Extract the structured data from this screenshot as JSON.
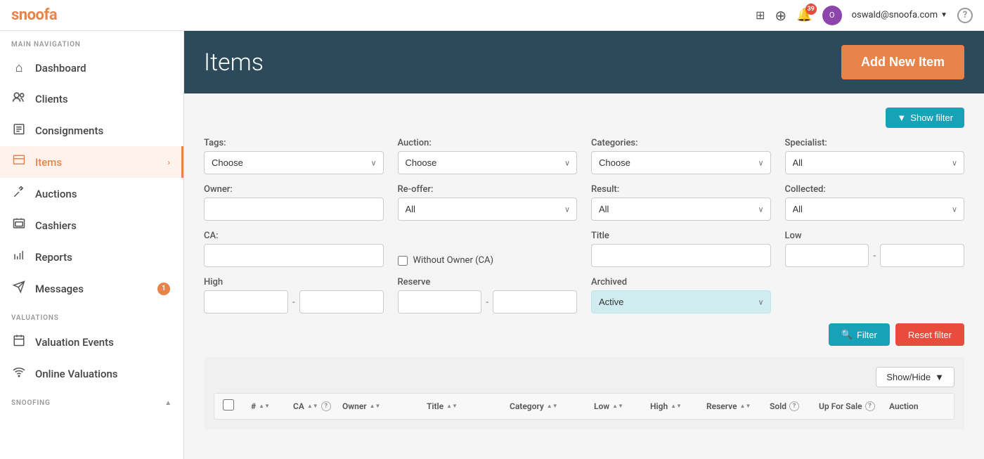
{
  "topbar": {
    "logo_part1": "snoo",
    "logo_part2": "fa",
    "notification_count": "39",
    "user_email": "oswald@snoofa.com"
  },
  "sidebar": {
    "main_nav_label": "MAIN NAVIGATION",
    "items": [
      {
        "id": "dashboard",
        "label": "Dashboard",
        "icon": "⌂",
        "active": false
      },
      {
        "id": "clients",
        "label": "Clients",
        "icon": "👥",
        "active": false
      },
      {
        "id": "consignments",
        "label": "Consignments",
        "icon": "📋",
        "active": false
      },
      {
        "id": "items",
        "label": "Items",
        "icon": "🏷",
        "active": true,
        "chevron": true
      },
      {
        "id": "auctions",
        "label": "Auctions",
        "icon": "✏",
        "active": false
      },
      {
        "id": "cashiers",
        "label": "Cashiers",
        "icon": "🖥",
        "active": false
      },
      {
        "id": "reports",
        "label": "Reports",
        "icon": "📊",
        "active": false
      },
      {
        "id": "messages",
        "label": "Messages",
        "icon": "✉",
        "active": false,
        "badge": "1"
      }
    ],
    "valuations_label": "VALUATIONS",
    "valuations_items": [
      {
        "id": "valuation-events",
        "label": "Valuation Events",
        "icon": "📅"
      },
      {
        "id": "online-valuations",
        "label": "Online Valuations",
        "icon": "📡"
      }
    ],
    "snoofing_label": "SNOOFING"
  },
  "page_header": {
    "title": "Items",
    "add_button_label": "Add New Item"
  },
  "filters": {
    "show_filter_label": "Show filter",
    "tags_label": "Tags:",
    "tags_placeholder": "Choose",
    "auction_label": "Auction:",
    "auction_placeholder": "Choose",
    "categories_label": "Categories:",
    "categories_placeholder": "Choose",
    "specialist_label": "Specialist:",
    "specialist_placeholder": "All",
    "owner_label": "Owner:",
    "reoffer_label": "Re-offer:",
    "reoffer_value": "All",
    "result_label": "Result:",
    "result_value": "All",
    "collected_label": "Collected:",
    "collected_value": "All",
    "ca_label": "CA:",
    "without_owner_label": "Without Owner (CA)",
    "title_label": "Title",
    "low_label": "Low",
    "high_label": "High",
    "reserve_label": "Reserve",
    "archived_label": "Archived",
    "archived_value": "Active",
    "filter_button": "Filter",
    "reset_button": "Reset filter"
  },
  "table": {
    "show_hide_label": "Show/Hide",
    "columns": [
      {
        "id": "num",
        "label": "#",
        "sortable": true,
        "help": false
      },
      {
        "id": "ca",
        "label": "CA",
        "sortable": true,
        "help": true
      },
      {
        "id": "owner",
        "label": "Owner",
        "sortable": true,
        "help": false
      },
      {
        "id": "title",
        "label": "Title",
        "sortable": true,
        "help": false
      },
      {
        "id": "category",
        "label": "Category",
        "sortable": true,
        "help": false
      },
      {
        "id": "low",
        "label": "Low",
        "sortable": true,
        "help": false
      },
      {
        "id": "high",
        "label": "High",
        "sortable": true,
        "help": false
      },
      {
        "id": "reserve",
        "label": "Reserve",
        "sortable": true,
        "help": false
      },
      {
        "id": "sold",
        "label": "Sold",
        "sortable": false,
        "help": true
      },
      {
        "id": "upforsale",
        "label": "Up For Sale",
        "sortable": false,
        "help": true
      },
      {
        "id": "auction",
        "label": "Auction",
        "sortable": false,
        "help": false
      }
    ]
  }
}
